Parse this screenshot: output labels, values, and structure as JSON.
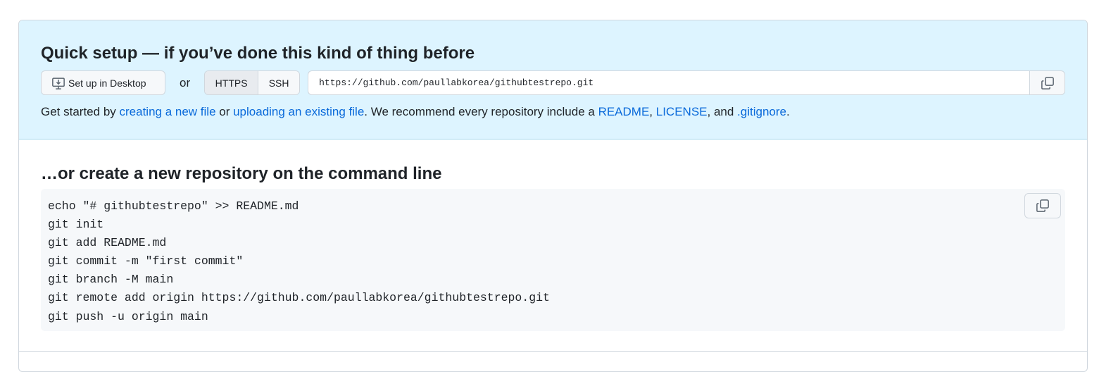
{
  "quick_setup": {
    "title": "Quick setup — if you’ve done this kind of thing before",
    "desktop_button_label": "Set up in Desktop",
    "or_label": "or",
    "protocols": [
      "HTTPS",
      "SSH"
    ],
    "selected_protocol": "HTTPS",
    "clone_url": "https://github.com/paullabkorea/githubtestrepo.git",
    "hint": {
      "prefix": "Get started by ",
      "link_new_file": "creating a new file",
      "middle": " or ",
      "link_upload": "uploading an existing file",
      "after_upload": ". We recommend every repository include a ",
      "link_readme": "README",
      "comma": ", ",
      "link_license": "LICENSE",
      "and_text": ", and ",
      "link_gitignore": ".gitignore",
      "suffix": "."
    }
  },
  "command_line": {
    "title": "…or create a new repository on the command line",
    "lines": [
      "echo \"# githubtestrepo\" >> README.md",
      "git init",
      "git add README.md",
      "git commit -m \"first commit\"",
      "git branch -M main",
      "git remote add origin https://github.com/paullabkorea/githubtestrepo.git",
      "git push -u origin main"
    ]
  },
  "icons": {
    "desktop": "desktop-download-icon",
    "copy": "copy-icon"
  },
  "colors": {
    "quick_setup_bg": "#ddf4ff",
    "link": "#0969da",
    "code_bg": "#f6f8fa",
    "border": "#d0d7de"
  }
}
